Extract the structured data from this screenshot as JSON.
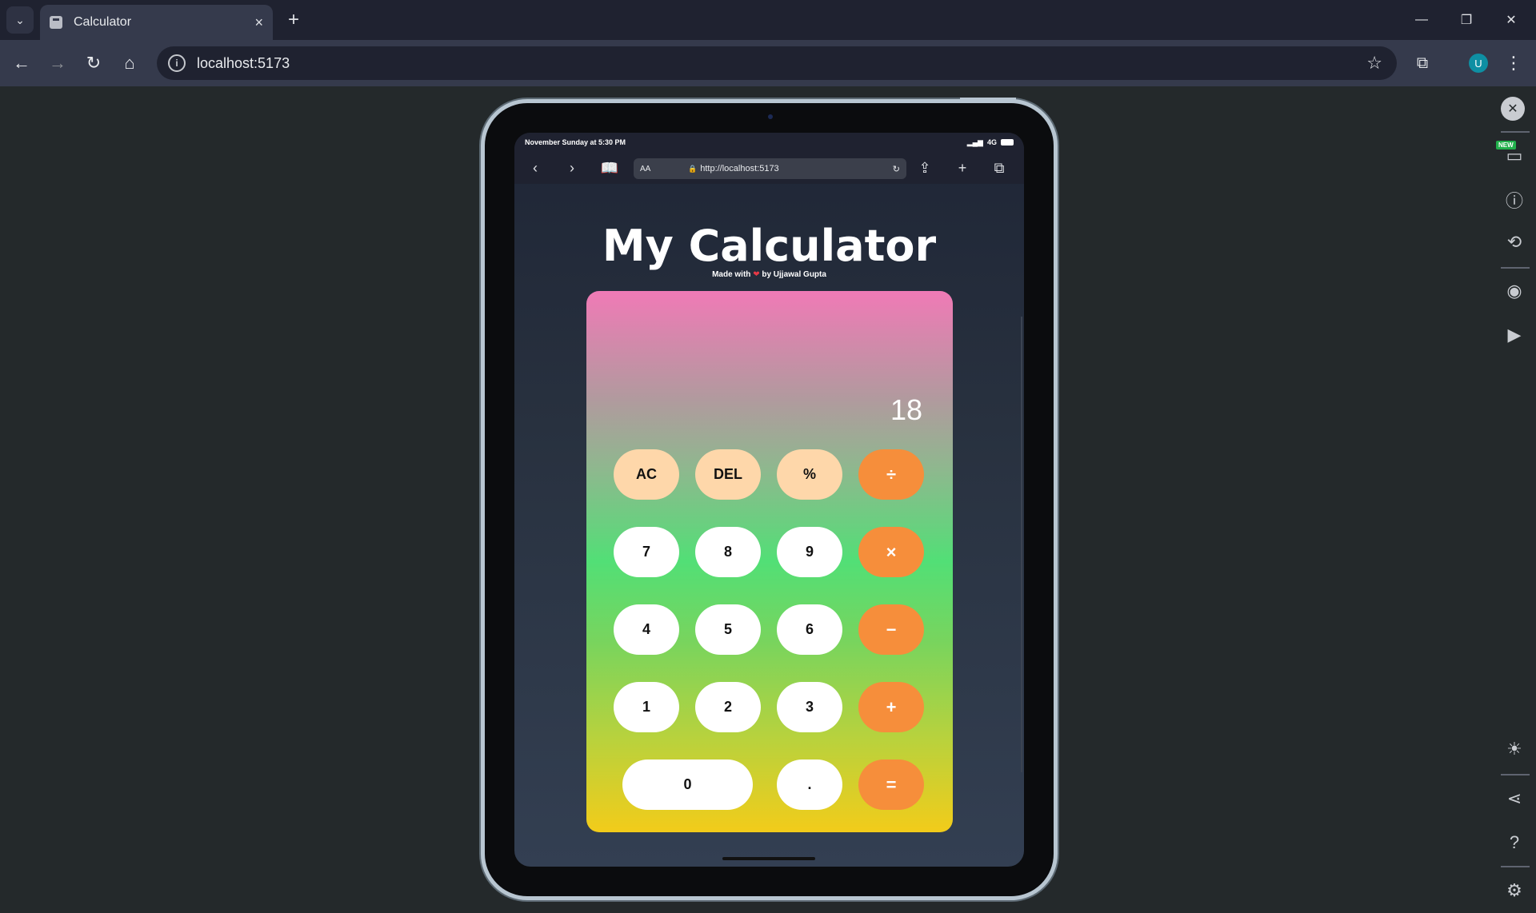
{
  "browser": {
    "tab_title": "Calculator",
    "tab_close": "×",
    "new_tab": "+",
    "url": "localhost:5173",
    "info_icon": "i",
    "avatar_initial": "U",
    "window_controls": {
      "minimize": "—",
      "restore": "❐",
      "close": "✕"
    }
  },
  "devtools_side": {
    "new_badge": "NEW"
  },
  "device": {
    "status_time": "November Sunday at 5:30 PM",
    "status_network": "4G",
    "safari": {
      "text_size": "AA",
      "address": "http://localhost:5173"
    }
  },
  "app": {
    "title": "My Calculator",
    "subtitle_prefix": "Made with",
    "subtitle_heart": "❤",
    "subtitle_suffix": "by Ujjawal Gupta",
    "display_value": "18",
    "keys": {
      "ac": "AC",
      "del": "DEL",
      "percent": "%",
      "divide": "÷",
      "seven": "7",
      "eight": "8",
      "nine": "9",
      "multiply": "×",
      "four": "4",
      "five": "5",
      "six": "6",
      "minus": "−",
      "one": "1",
      "two": "2",
      "three": "3",
      "plus": "+",
      "zero": "0",
      "dot": ".",
      "equals": "="
    }
  },
  "colors": {
    "util_key": "#fed7aa",
    "num_key": "#ffffff",
    "op_key": "#f68e3b",
    "gradient_top": "#f07ab6",
    "gradient_mid": "#52df76",
    "gradient_bottom": "#f2cc1a"
  }
}
